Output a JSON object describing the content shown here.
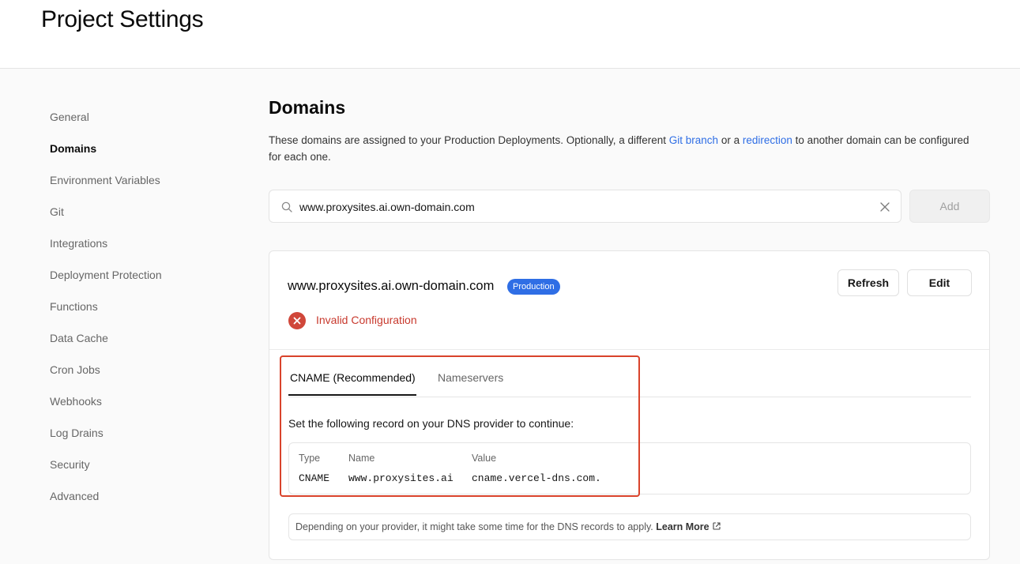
{
  "header": {
    "title": "Project Settings"
  },
  "sidebar": {
    "items": [
      {
        "label": "General"
      },
      {
        "label": "Domains",
        "active": true
      },
      {
        "label": "Environment Variables"
      },
      {
        "label": "Git"
      },
      {
        "label": "Integrations"
      },
      {
        "label": "Deployment Protection"
      },
      {
        "label": "Functions"
      },
      {
        "label": "Data Cache"
      },
      {
        "label": "Cron Jobs"
      },
      {
        "label": "Webhooks"
      },
      {
        "label": "Log Drains"
      },
      {
        "label": "Security"
      },
      {
        "label": "Advanced"
      }
    ]
  },
  "main": {
    "title": "Domains",
    "description": {
      "part1": "These domains are assigned to your Production Deployments. Optionally, a different ",
      "link1": "Git branch",
      "part2": " or a ",
      "link2": "redirection",
      "part3": " to another domain can be configured for each one."
    },
    "search": {
      "value": "www.proxysites.ai.own-domain.com",
      "icon": "search-icon",
      "clear_icon": "close-icon"
    },
    "add_button": "Add"
  },
  "domain_card": {
    "domain": "www.proxysites.ai.own-domain.com",
    "badge": "Production",
    "refresh_button": "Refresh",
    "edit_button": "Edit",
    "status": "Invalid Configuration",
    "tabs": [
      {
        "label": "CNAME (Recommended)",
        "active": true
      },
      {
        "label": "Nameservers"
      }
    ],
    "instruction": "Set the following record on your DNS provider to continue:",
    "table": {
      "headers": [
        "Type",
        "Name",
        "Value"
      ],
      "rows": [
        [
          "CNAME",
          "www.proxysites.ai",
          "cname.vercel-dns.com."
        ]
      ]
    },
    "note": {
      "text": "Depending on your provider, it might take some time for the DNS records to apply. ",
      "link": "Learn More"
    }
  },
  "colors": {
    "accent": "#2f6ee5",
    "error": "#c8392d",
    "highlight": "#d9432b"
  }
}
